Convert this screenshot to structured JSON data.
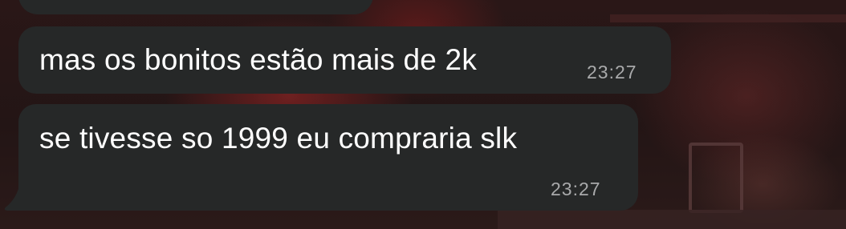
{
  "conversation": {
    "messages": [
      {
        "text": "mas os bonitos estão mais de 2k",
        "time": "23:27"
      },
      {
        "text": "se tivesse so 1999 eu compraria slk",
        "time": "23:27"
      }
    ]
  },
  "colors": {
    "bubble": "#262828",
    "text": "#ffffff",
    "timestamp": "#a9aaab",
    "wallpaper_accent": "#aa2828"
  }
}
